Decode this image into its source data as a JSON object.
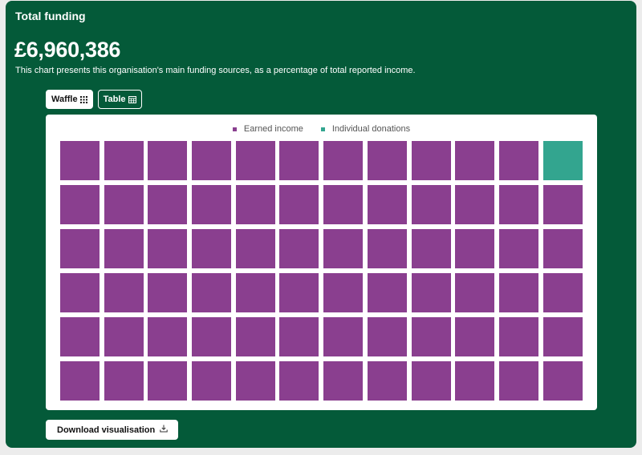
{
  "card": {
    "title": "Total funding",
    "total": "£6,960,386",
    "description": "This chart presents this organisation's main funding sources, as a percentage of total reported income."
  },
  "view_toggle": {
    "waffle_label": "Waffle",
    "waffle_icon": "grid-icon",
    "table_label": "Table",
    "table_icon": "table-icon",
    "active": "waffle"
  },
  "chart_data": {
    "type": "waffle",
    "total_cells": 72,
    "columns": 12,
    "series": [
      {
        "name": "Earned income",
        "cells": 71,
        "color": "#8a3f8f"
      },
      {
        "name": "Individual donations",
        "cells": 1,
        "color": "#33a58f"
      }
    ]
  },
  "download": {
    "label": "Download visualisation",
    "icon": "download-icon"
  },
  "colors": {
    "card_background": "#045a39",
    "panel_background": "#ffffff"
  }
}
